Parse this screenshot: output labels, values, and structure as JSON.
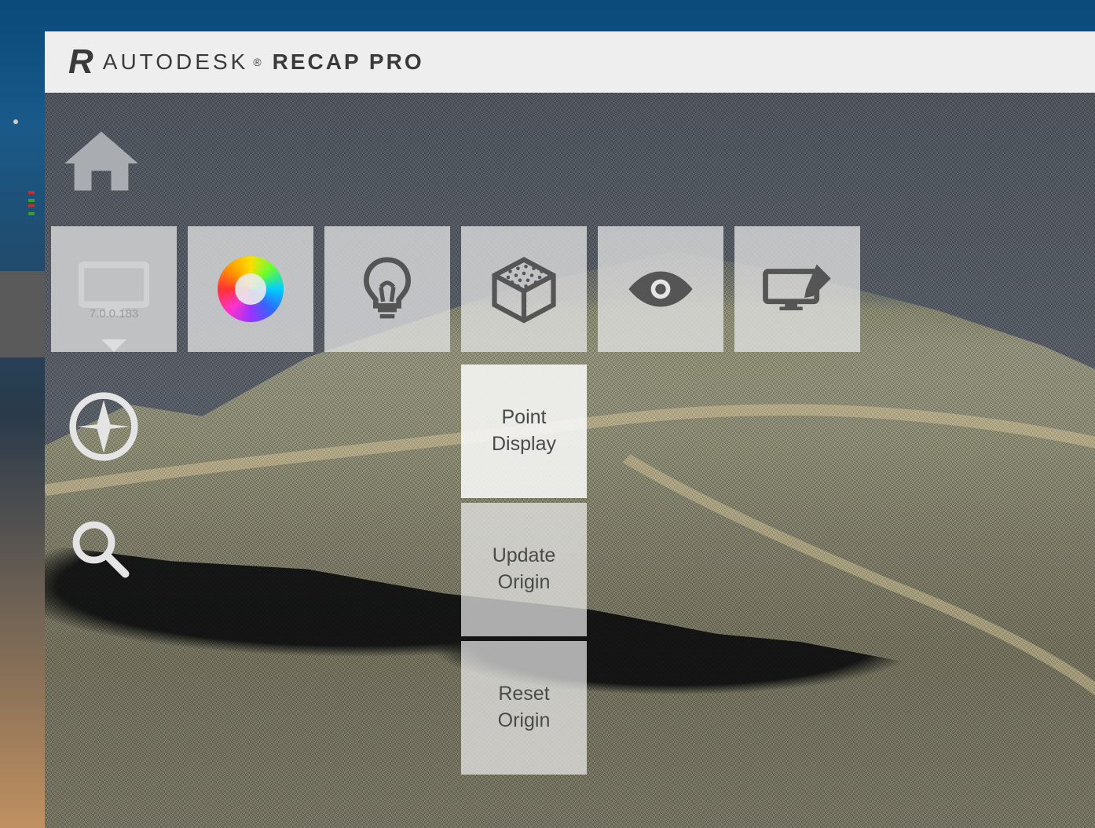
{
  "header": {
    "logo_letter": "R",
    "brand_autodesk": "AUTODESK",
    "brand_mark": "®",
    "brand_product": "RECAP PRO"
  },
  "version_label": "7.0.0.183",
  "toolbar": {
    "items": [
      {
        "name": "display-settings",
        "icon": "monitor"
      },
      {
        "name": "color-mode",
        "icon": "color-wheel"
      },
      {
        "name": "lighting",
        "icon": "bulb"
      },
      {
        "name": "points",
        "icon": "point-cube",
        "active": true
      },
      {
        "name": "visibility",
        "icon": "eye"
      },
      {
        "name": "ui-theme",
        "icon": "screen-pen"
      }
    ]
  },
  "points_menu": {
    "items": [
      {
        "label_line1": "Point",
        "label_line2": "Display",
        "active": true
      },
      {
        "label_line1": "Update",
        "label_line2": "Origin"
      },
      {
        "label_line1": "Reset",
        "label_line2": "Origin"
      }
    ]
  }
}
